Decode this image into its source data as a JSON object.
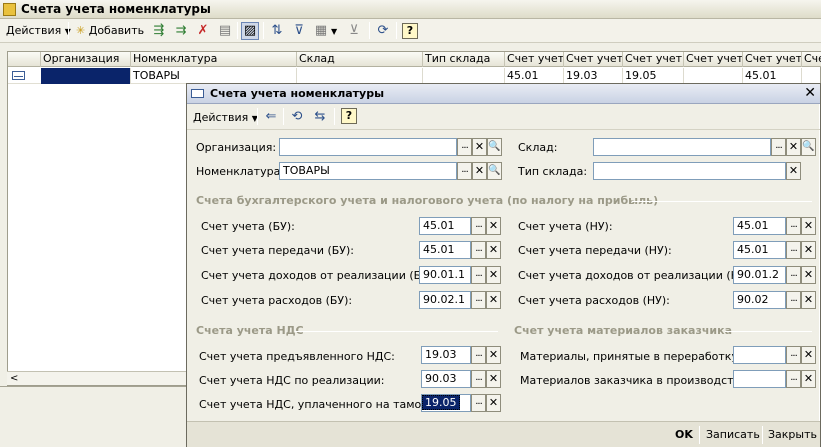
{
  "main": {
    "title": "Счета учета номенклатуры",
    "toolbar": {
      "actions_label": "Действия",
      "add_label": "Добавить",
      "help_label": "?"
    },
    "grid": {
      "columns": [
        "Организация",
        "Номенклатура",
        "Склад",
        "Тип склада",
        "Счет учет...",
        "Счет учет...",
        "Счет учет...",
        "Счет учет...",
        "Счет учет...",
        "Сче"
      ],
      "row": [
        "",
        "ТОВАРЫ",
        "",
        "",
        "45.01",
        "19.03",
        "19.05",
        "",
        "45.01",
        ""
      ]
    },
    "scroll_left": "<"
  },
  "dialog": {
    "title": "Счета учета номенклатуры",
    "close_label": "✕",
    "toolbar": {
      "actions_label": "Действия",
      "help_label": "?"
    },
    "top_fields": {
      "organization": {
        "label": "Организация:",
        "value": ""
      },
      "nomenclature": {
        "label": "Номенклатура:",
        "value": "ТОВАРЫ"
      },
      "warehouse": {
        "label": "Склад:",
        "value": ""
      },
      "warehouse_type": {
        "label": "Тип склада:",
        "value": ""
      }
    },
    "section_accounting": {
      "title": "Счета бухгалтерского учета и налогового учета (по налогу на прибыль)",
      "bu": [
        {
          "label": "Счет учета (БУ):",
          "value": "45.01"
        },
        {
          "label": "Счет учета передачи (БУ):",
          "value": "45.01"
        },
        {
          "label": "Счет учета доходов от реализации (БУ):",
          "value": "90.01.1"
        },
        {
          "label": "Счет учета расходов (БУ):",
          "value": "90.02.1"
        }
      ],
      "nu": [
        {
          "label": "Счет учета (НУ):",
          "value": "45.01"
        },
        {
          "label": "Счет учета передачи (НУ):",
          "value": "45.01"
        },
        {
          "label": "Счет учета доходов от реализации (НУ):",
          "value": "90.01.2"
        },
        {
          "label": "Счет учета расходов (НУ):",
          "value": "90.02"
        }
      ]
    },
    "section_vat": {
      "title": "Счета учета НДС",
      "items": [
        {
          "label": "Счет учета предъявленного НДС:",
          "value": "19.03"
        },
        {
          "label": "Счет учета НДС по реализации:",
          "value": "90.03"
        },
        {
          "label": "Счет учета НДС, уплаченного на таможне:",
          "value": "19.05"
        }
      ]
    },
    "section_customer": {
      "title": "Счет учета материалов заказчика",
      "items": [
        {
          "label": "Материалы, принятые в переработку:",
          "value": ""
        },
        {
          "label": "Материалов заказчика в производстве:",
          "value": ""
        }
      ]
    },
    "footer": {
      "ok_label": "OK",
      "save_label": "Записать",
      "close_label": "Закрыть"
    },
    "field_buttons": {
      "choose": "...",
      "clear": "✕",
      "open": "🔍"
    }
  }
}
